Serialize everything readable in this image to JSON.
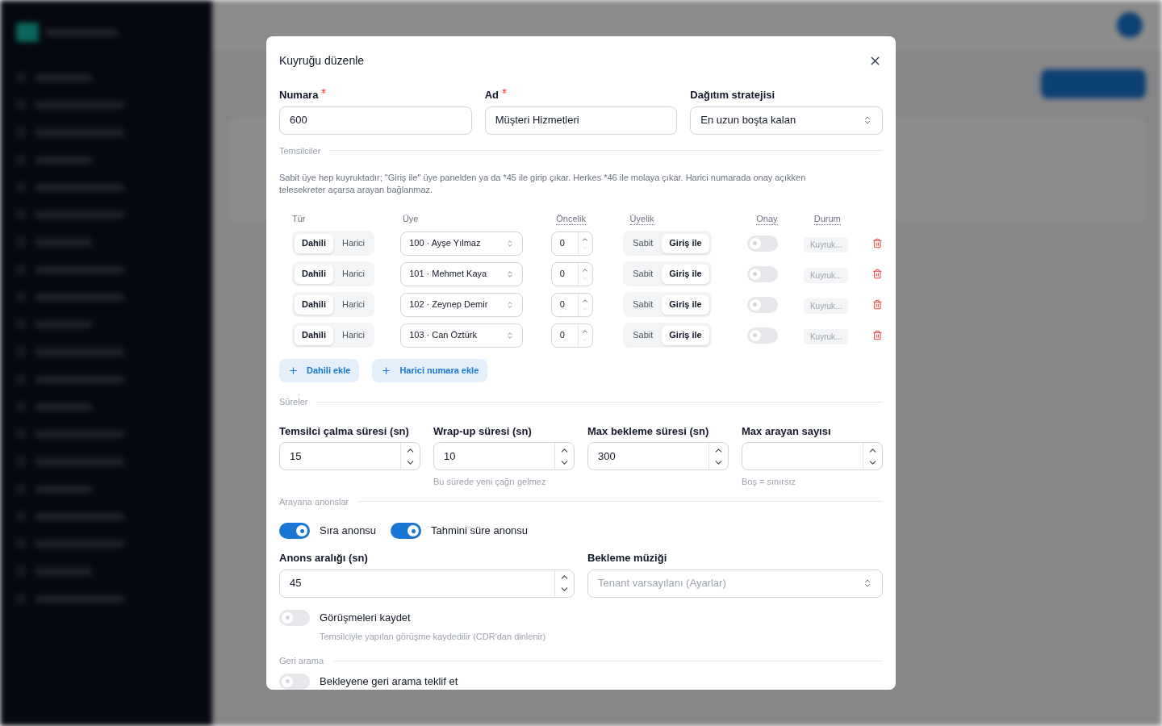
{
  "modal": {
    "title": "Kuyruğu düzenle",
    "fields": [
      {
        "label": "Numara",
        "required": true,
        "value": "600",
        "kind": "text"
      },
      {
        "label": "Ad",
        "required": true,
        "value": "Müşteri Hizmetleri",
        "kind": "text"
      },
      {
        "label": "Dağıtım stratejisi",
        "required": false,
        "value": "En uzun boşta kalan",
        "kind": "select"
      }
    ],
    "agents": {
      "title": "Temsilciler",
      "help": "Sabit üye hep kuyruktadır; \"Giriş ile\" üye panelden ya da *45 ile girip çıkar. Herkes *46 ile molaya çıkar. Harici numarada onay açıkken telesekreter açarsa arayan bağlanmaz.",
      "columns": [
        {
          "label": "Tür",
          "dotted": false
        },
        {
          "label": "Üye",
          "dotted": false
        },
        {
          "label": "Öncelik",
          "dotted": true
        },
        {
          "label": "Üyelik",
          "dotted": true
        },
        {
          "label": "Onay",
          "dotted": true
        },
        {
          "label": "Durum",
          "dotted": true
        }
      ],
      "rows": [
        {
          "type": [
            {
              "label": "Dahili",
              "selected": true
            },
            {
              "label": "Harici",
              "selected": false
            }
          ],
          "member": "100 · Ayşe Yılmaz",
          "priority": "0",
          "membership": [
            {
              "label": "Sabit",
              "selected": false
            },
            {
              "label": "Giriş ile",
              "selected": true
            }
          ],
          "confirm": false,
          "status": "Kuyruk..."
        },
        {
          "type": [
            {
              "label": "Dahili",
              "selected": true
            },
            {
              "label": "Harici",
              "selected": false
            }
          ],
          "member": "101 · Mehmet Kaya",
          "priority": "0",
          "membership": [
            {
              "label": "Sabit",
              "selected": false
            },
            {
              "label": "Giriş ile",
              "selected": true
            }
          ],
          "confirm": false,
          "status": "Kuyruk..."
        },
        {
          "type": [
            {
              "label": "Dahili",
              "selected": true
            },
            {
              "label": "Harici",
              "selected": false
            }
          ],
          "member": "102 · Zeynep Demir",
          "priority": "0",
          "membership": [
            {
              "label": "Sabit",
              "selected": false
            },
            {
              "label": "Giriş ile",
              "selected": true
            }
          ],
          "confirm": false,
          "status": "Kuyruk..."
        },
        {
          "type": [
            {
              "label": "Dahili",
              "selected": true
            },
            {
              "label": "Harici",
              "selected": false
            }
          ],
          "member": "103 · Can Öztürk",
          "priority": "0",
          "membership": [
            {
              "label": "Sabit",
              "selected": false
            },
            {
              "label": "Giriş ile",
              "selected": true
            }
          ],
          "confirm": false,
          "status": "Kuyruk..."
        }
      ],
      "add_buttons": [
        "Dahili ekle",
        "Harici numara ekle"
      ]
    },
    "timers": {
      "title": "Süreler",
      "fields": [
        {
          "label": "Temsilci çalma süresi (sn)",
          "value": "15"
        },
        {
          "label": "Wrap-up süresi (sn)",
          "value": "10",
          "hint": "Bu sürede yeni çağrı gelmez"
        },
        {
          "label": "Max bekleme süresi (sn)",
          "value": "300"
        },
        {
          "label": "Max arayan sayısı",
          "hint": "Boş = sınırsız"
        }
      ]
    },
    "announcements": {
      "title": "Arayana anonslar",
      "toggles": [
        {
          "label": "Sıra anonsu",
          "on": true
        },
        {
          "label": "Tahmini süre anonsu",
          "on": true
        }
      ],
      "interval": {
        "label": "Anons aralığı (sn)",
        "value": "45"
      },
      "music": {
        "label": "Bekleme müziği",
        "placeholder": "Tenant varsayılanı (Ayarlar)"
      },
      "record": {
        "label": "Görüşmeleri kaydet",
        "hint": "Temsilciyle yapılan görüşme kaydedilir (CDR'dan dinlenir)",
        "on": false
      }
    },
    "callback": {
      "title": "Geri arama",
      "toggle": {
        "label": "Bekleyene geri arama teklif et",
        "on": false
      }
    }
  }
}
